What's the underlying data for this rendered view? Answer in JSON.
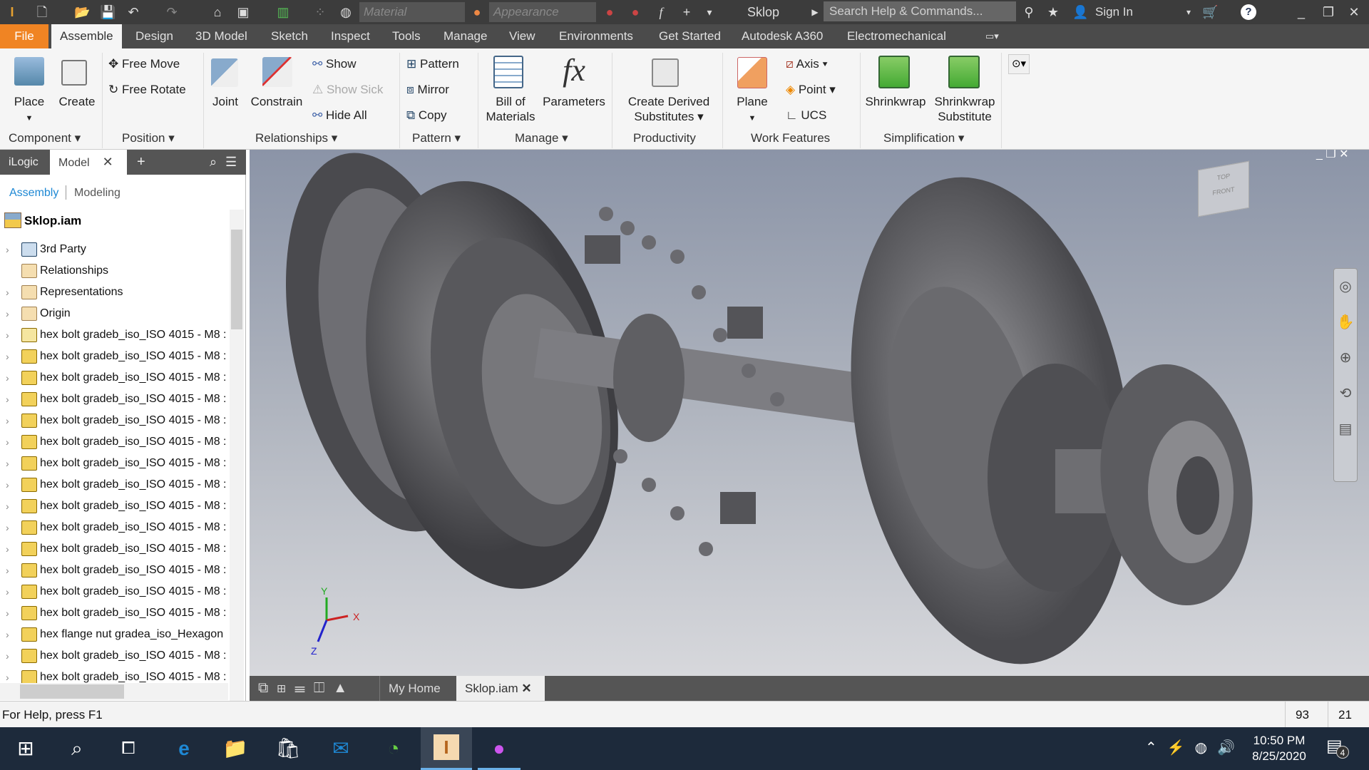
{
  "app": {
    "title": "Sklop",
    "logo": "PRO"
  },
  "quick_access": {
    "material_placeholder": "Material",
    "appearance_placeholder": "Appearance",
    "search_placeholder": "Search Help & Commands...",
    "sign_in": "Sign In"
  },
  "ribbon_tabs": [
    "File",
    "Assemble",
    "Design",
    "3D Model",
    "Sketch",
    "Inspect",
    "Tools",
    "Manage",
    "View",
    "Environments",
    "Get Started",
    "Autodesk A360",
    "Electromechanical"
  ],
  "active_tab": "Assemble",
  "ribbon": {
    "place": "Place",
    "create": "Create",
    "free_move": "Free Move",
    "free_rotate": "Free Rotate",
    "joint": "Joint",
    "constrain": "Constrain",
    "show": "Show",
    "show_sick": "Show Sick",
    "hide_all": "Hide All",
    "pattern": "Pattern",
    "mirror": "Mirror",
    "copy": "Copy",
    "bom_1": "Bill of",
    "bom_2": "Materials",
    "parameters": "Parameters",
    "derived_1": "Create Derived",
    "derived_2": "Substitutes",
    "plane": "Plane",
    "axis": "Axis",
    "point": "Point",
    "ucs": "UCS",
    "shrinkwrap": "Shrinkwrap",
    "shrinkwrap_sub_1": "Shrinkwrap",
    "shrinkwrap_sub_2": "Substitute",
    "groups": {
      "component": "Component",
      "position": "Position",
      "relationships": "Relationships",
      "pattern": "Pattern",
      "manage": "Manage",
      "productivity": "Productivity",
      "work_features": "Work Features",
      "simplification": "Simplification"
    }
  },
  "browser": {
    "tabs": [
      "iLogic",
      "Model"
    ],
    "modes": [
      "Assembly",
      "Modeling"
    ],
    "root": "Sklop.iam",
    "items": [
      {
        "label": "3rd Party",
        "icon": "party"
      },
      {
        "label": "Relationships",
        "icon": "folder"
      },
      {
        "label": "Representations",
        "icon": "folder"
      },
      {
        "label": "Origin",
        "icon": "folder"
      },
      {
        "label": "hex bolt gradeb_iso_ISO 4015 - M8 :",
        "icon": "pin"
      },
      {
        "label": "hex bolt gradeb_iso_ISO 4015 - M8 :",
        "icon": "part"
      },
      {
        "label": "hex bolt gradeb_iso_ISO 4015 - M8 :",
        "icon": "part"
      },
      {
        "label": "hex bolt gradeb_iso_ISO 4015 - M8 :",
        "icon": "part"
      },
      {
        "label": "hex bolt gradeb_iso_ISO 4015 - M8 :",
        "icon": "part"
      },
      {
        "label": "hex bolt gradeb_iso_ISO 4015 - M8 :",
        "icon": "part"
      },
      {
        "label": "hex bolt gradeb_iso_ISO 4015 - M8 :",
        "icon": "part"
      },
      {
        "label": "hex bolt gradeb_iso_ISO 4015 - M8 :",
        "icon": "part"
      },
      {
        "label": "hex bolt gradeb_iso_ISO 4015 - M8 :",
        "icon": "part"
      },
      {
        "label": "hex bolt gradeb_iso_ISO 4015 - M8 :",
        "icon": "part"
      },
      {
        "label": "hex bolt gradeb_iso_ISO 4015 - M8 :",
        "icon": "part"
      },
      {
        "label": "hex bolt gradeb_iso_ISO 4015 - M8 :",
        "icon": "part"
      },
      {
        "label": "hex bolt gradeb_iso_ISO 4015 - M8 :",
        "icon": "part"
      },
      {
        "label": "hex bolt gradeb_iso_ISO 4015 - M8 :",
        "icon": "part"
      },
      {
        "label": "hex flange nut gradea_iso_Hexagon",
        "icon": "part"
      },
      {
        "label": "hex bolt gradeb_iso_ISO 4015 - M8 :",
        "icon": "part"
      },
      {
        "label": "hex bolt gradeb_iso_ISO 4015 - M8 :",
        "icon": "part"
      }
    ]
  },
  "viewcube": {
    "top": "TOP",
    "front": "FRONT"
  },
  "triad": {
    "x": "X",
    "y": "Y",
    "z": "Z"
  },
  "doc_tabs": [
    "My Home",
    "Sklop.iam"
  ],
  "status": {
    "help": "For Help, press F1",
    "count1": "93",
    "count2": "21"
  },
  "taskbar": {
    "time": "10:50 PM",
    "date": "8/25/2020",
    "notifications": "4"
  },
  "colors": {
    "file_tab": "#f08423",
    "accent_link": "#1e88d4",
    "taskbar": "#1d2a3b"
  }
}
